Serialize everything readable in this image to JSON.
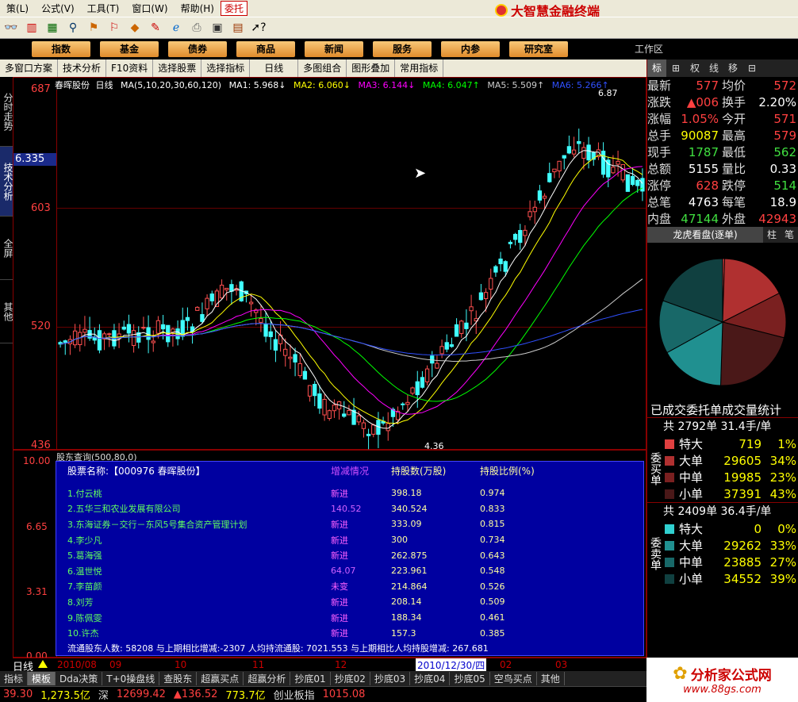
{
  "menu": {
    "items": [
      "策(L)",
      "公式(V)",
      "工具(T)",
      "窗口(W)",
      "帮助(H)"
    ],
    "weituo": "委托",
    "app_title": "大智慧金融终端"
  },
  "nav": {
    "buttons": [
      "指数",
      "基金",
      "债券",
      "商品",
      "新闻",
      "服务",
      "内参",
      "研究室"
    ],
    "workzone": "工作区"
  },
  "subbar": {
    "items": [
      "多窗口方案",
      "技术分析",
      "F10资料",
      "选择股票",
      "选择指标",
      "日线",
      "多图组合",
      "图形叠加",
      "常用指标"
    ]
  },
  "left_tabs": [
    {
      "label": "分时走势",
      "active": false
    },
    {
      "label": "技术分析",
      "active": true
    },
    {
      "label": "全屏",
      "active": false
    },
    {
      "label": "其他",
      "active": false
    }
  ],
  "chart": {
    "stock_name": "春晖股份",
    "period": "日线",
    "ma_header": "MA(5,10,20,30,60,120)",
    "ma_values": [
      {
        "label": "MA1: 5.968↓",
        "color": "#ffffff"
      },
      {
        "label": "MA2: 6.060↓",
        "color": "#ffff00"
      },
      {
        "label": "MA3: 6.144↓",
        "color": "#ff00ff"
      },
      {
        "label": "MA4: 6.047↑",
        "color": "#00ff00"
      },
      {
        "label": "MA5: 5.509↑",
        "color": "#cccccc"
      },
      {
        "label": "MA6: 5.266↑",
        "color": "#3050ff"
      }
    ],
    "y_ticks": [
      "687",
      "603",
      "520",
      "436"
    ],
    "cursor_price": "6.335",
    "high_label": "6.87",
    "low_label": "4.36"
  },
  "subchart": {
    "title": "股东查询(500,80,0)",
    "y_ticks": [
      "10.00",
      "6.65",
      "3.31",
      "0.00"
    ]
  },
  "holders": {
    "stock_label": "股票名称:【000976 春晖股份】",
    "col_change": "增减情况",
    "col_shares": "持股数(万股)",
    "col_ratio": "持股比例(%)",
    "rows": [
      {
        "name": "1.付云桃",
        "change": "新进",
        "shares": "398.18",
        "ratio": "0.974"
      },
      {
        "name": "2.五华三和农业发展有限公司",
        "change": "140.52",
        "shares": "340.524",
        "ratio": "0.833"
      },
      {
        "name": "3.东海证券－交行－东风5号集合资产管理计划",
        "change": "新进",
        "shares": "333.09",
        "ratio": "0.815"
      },
      {
        "name": "4.李少凡",
        "change": "新进",
        "shares": "300",
        "ratio": "0.734"
      },
      {
        "name": "5.葛海强",
        "change": "新进",
        "shares": "262.875",
        "ratio": "0.643"
      },
      {
        "name": "6.温世悦",
        "change": "64.07",
        "shares": "223.961",
        "ratio": "0.548"
      },
      {
        "name": "7.李苗颜",
        "change": "未变",
        "shares": "214.864",
        "ratio": "0.526"
      },
      {
        "name": "8.刘芳",
        "change": "新进",
        "shares": "208.14",
        "ratio": "0.509"
      },
      {
        "name": "9.陈佩雯",
        "change": "新进",
        "shares": "188.34",
        "ratio": "0.461"
      },
      {
        "name": "10.许杰",
        "change": "新进",
        "shares": "157.3",
        "ratio": "0.385"
      }
    ],
    "footer": "流通股东人数: 58208   与上期相比增减:-2307   人均持流通股: 7021.553   与上期相比人均持股增减: 267.681"
  },
  "timebar": {
    "period": "日线",
    "labels": [
      "2010/08",
      "09",
      "10",
      "11",
      "12",
      "2010/12/30/四",
      "02",
      "03"
    ]
  },
  "tabs": [
    "指标",
    "模板",
    "Dda决策",
    "T+0操盘线",
    "查股东",
    "超赢买点",
    "超赢分析",
    "抄底01",
    "抄底02",
    "抄底03",
    "抄底04",
    "抄底05",
    "空鸟买点",
    "其他"
  ],
  "status": {
    "items": [
      {
        "text": "39.30",
        "color": "#ff4040"
      },
      {
        "text": "1,273.5亿",
        "color": "#ffff00"
      },
      {
        "text": "深",
        "color": "#dddddd"
      },
      {
        "text": "12699.42",
        "color": "#ff4040"
      },
      {
        "text": "▲136.52",
        "color": "#ff4040"
      },
      {
        "text": "773.7亿",
        "color": "#ffff00"
      },
      {
        "text": "创业板指",
        "color": "#dddddd"
      },
      {
        "text": "1015.08",
        "color": "#ff4040"
      }
    ]
  },
  "quote": {
    "tabs": [
      "标",
      "⊞",
      "权",
      "线",
      "移",
      "⊟"
    ],
    "rows": [
      {
        "l1": "最新",
        "v1": "577",
        "c1": "red",
        "l2": "均价",
        "v2": "572",
        "c2": "red"
      },
      {
        "l1": "涨跌",
        "v1": "▲006",
        "c1": "red",
        "l2": "换手",
        "v2": "2.20%",
        "c2": "white"
      },
      {
        "l1": "涨幅",
        "v1": "1.05%",
        "c1": "red",
        "l2": "今开",
        "v2": "571",
        "c2": "red"
      },
      {
        "l1": "总手",
        "v1": "90087",
        "c1": "yellow",
        "l2": "最高",
        "v2": "579",
        "c2": "red"
      },
      {
        "l1": "现手",
        "v1": "1787",
        "c1": "green",
        "l2": "最低",
        "v2": "562",
        "c2": "green"
      },
      {
        "l1": "总额",
        "v1": "5155",
        "c1": "white",
        "l2": "量比",
        "v2": "0.33",
        "c2": "white"
      },
      {
        "l1": "涨停",
        "v1": "628",
        "c1": "red",
        "l2": "跌停",
        "v2": "514",
        "c2": "green"
      },
      {
        "l1": "总笔",
        "v1": "4763",
        "c1": "white",
        "l2": "每笔",
        "v2": "18.9",
        "c2": "white"
      },
      {
        "l1": "内盘",
        "v1": "47144",
        "c1": "green",
        "l2": "外盘",
        "v2": "42943",
        "c2": "red"
      }
    ],
    "panel_tabs": [
      "龙虎看盘(逐单)",
      "柱",
      "笔"
    ],
    "stats_title": "已成交委托单成交量统计",
    "buy": {
      "side_label": "委买单",
      "summary": "共 2792单 31.4手/单",
      "rows": [
        {
          "label": "特大",
          "value": "719",
          "pct": "1%",
          "color": "#e04040"
        },
        {
          "label": "大单",
          "value": "29605",
          "pct": "34%",
          "color": "#b03030"
        },
        {
          "label": "中单",
          "value": "19985",
          "pct": "23%",
          "color": "#7a2020"
        },
        {
          "label": "小单",
          "value": "37391",
          "pct": "43%",
          "color": "#4a1818"
        }
      ]
    },
    "sell": {
      "side_label": "委卖单",
      "summary": "共 2409单 36.4手/单",
      "rows": [
        {
          "label": "特大",
          "value": "0",
          "pct": "0%",
          "color": "#30d0d0"
        },
        {
          "label": "大单",
          "value": "29262",
          "pct": "33%",
          "color": "#209090"
        },
        {
          "label": "中单",
          "value": "23885",
          "pct": "27%",
          "color": "#186868"
        },
        {
          "label": "小单",
          "value": "34552",
          "pct": "39%",
          "color": "#104040"
        }
      ]
    },
    "pie": [
      {
        "pct": 1,
        "color": "#e04040"
      },
      {
        "pct": 34,
        "color": "#b03030"
      },
      {
        "pct": 23,
        "color": "#7a2020"
      },
      {
        "pct": 43,
        "color": "#4a1818"
      },
      {
        "pct": 0,
        "color": "#30d0d0"
      },
      {
        "pct": 33,
        "color": "#209090"
      },
      {
        "pct": 27,
        "color": "#186868"
      },
      {
        "pct": 39,
        "color": "#104040"
      }
    ]
  },
  "logo": {
    "text": "分析家公式网",
    "url": "www.88gs.com"
  }
}
